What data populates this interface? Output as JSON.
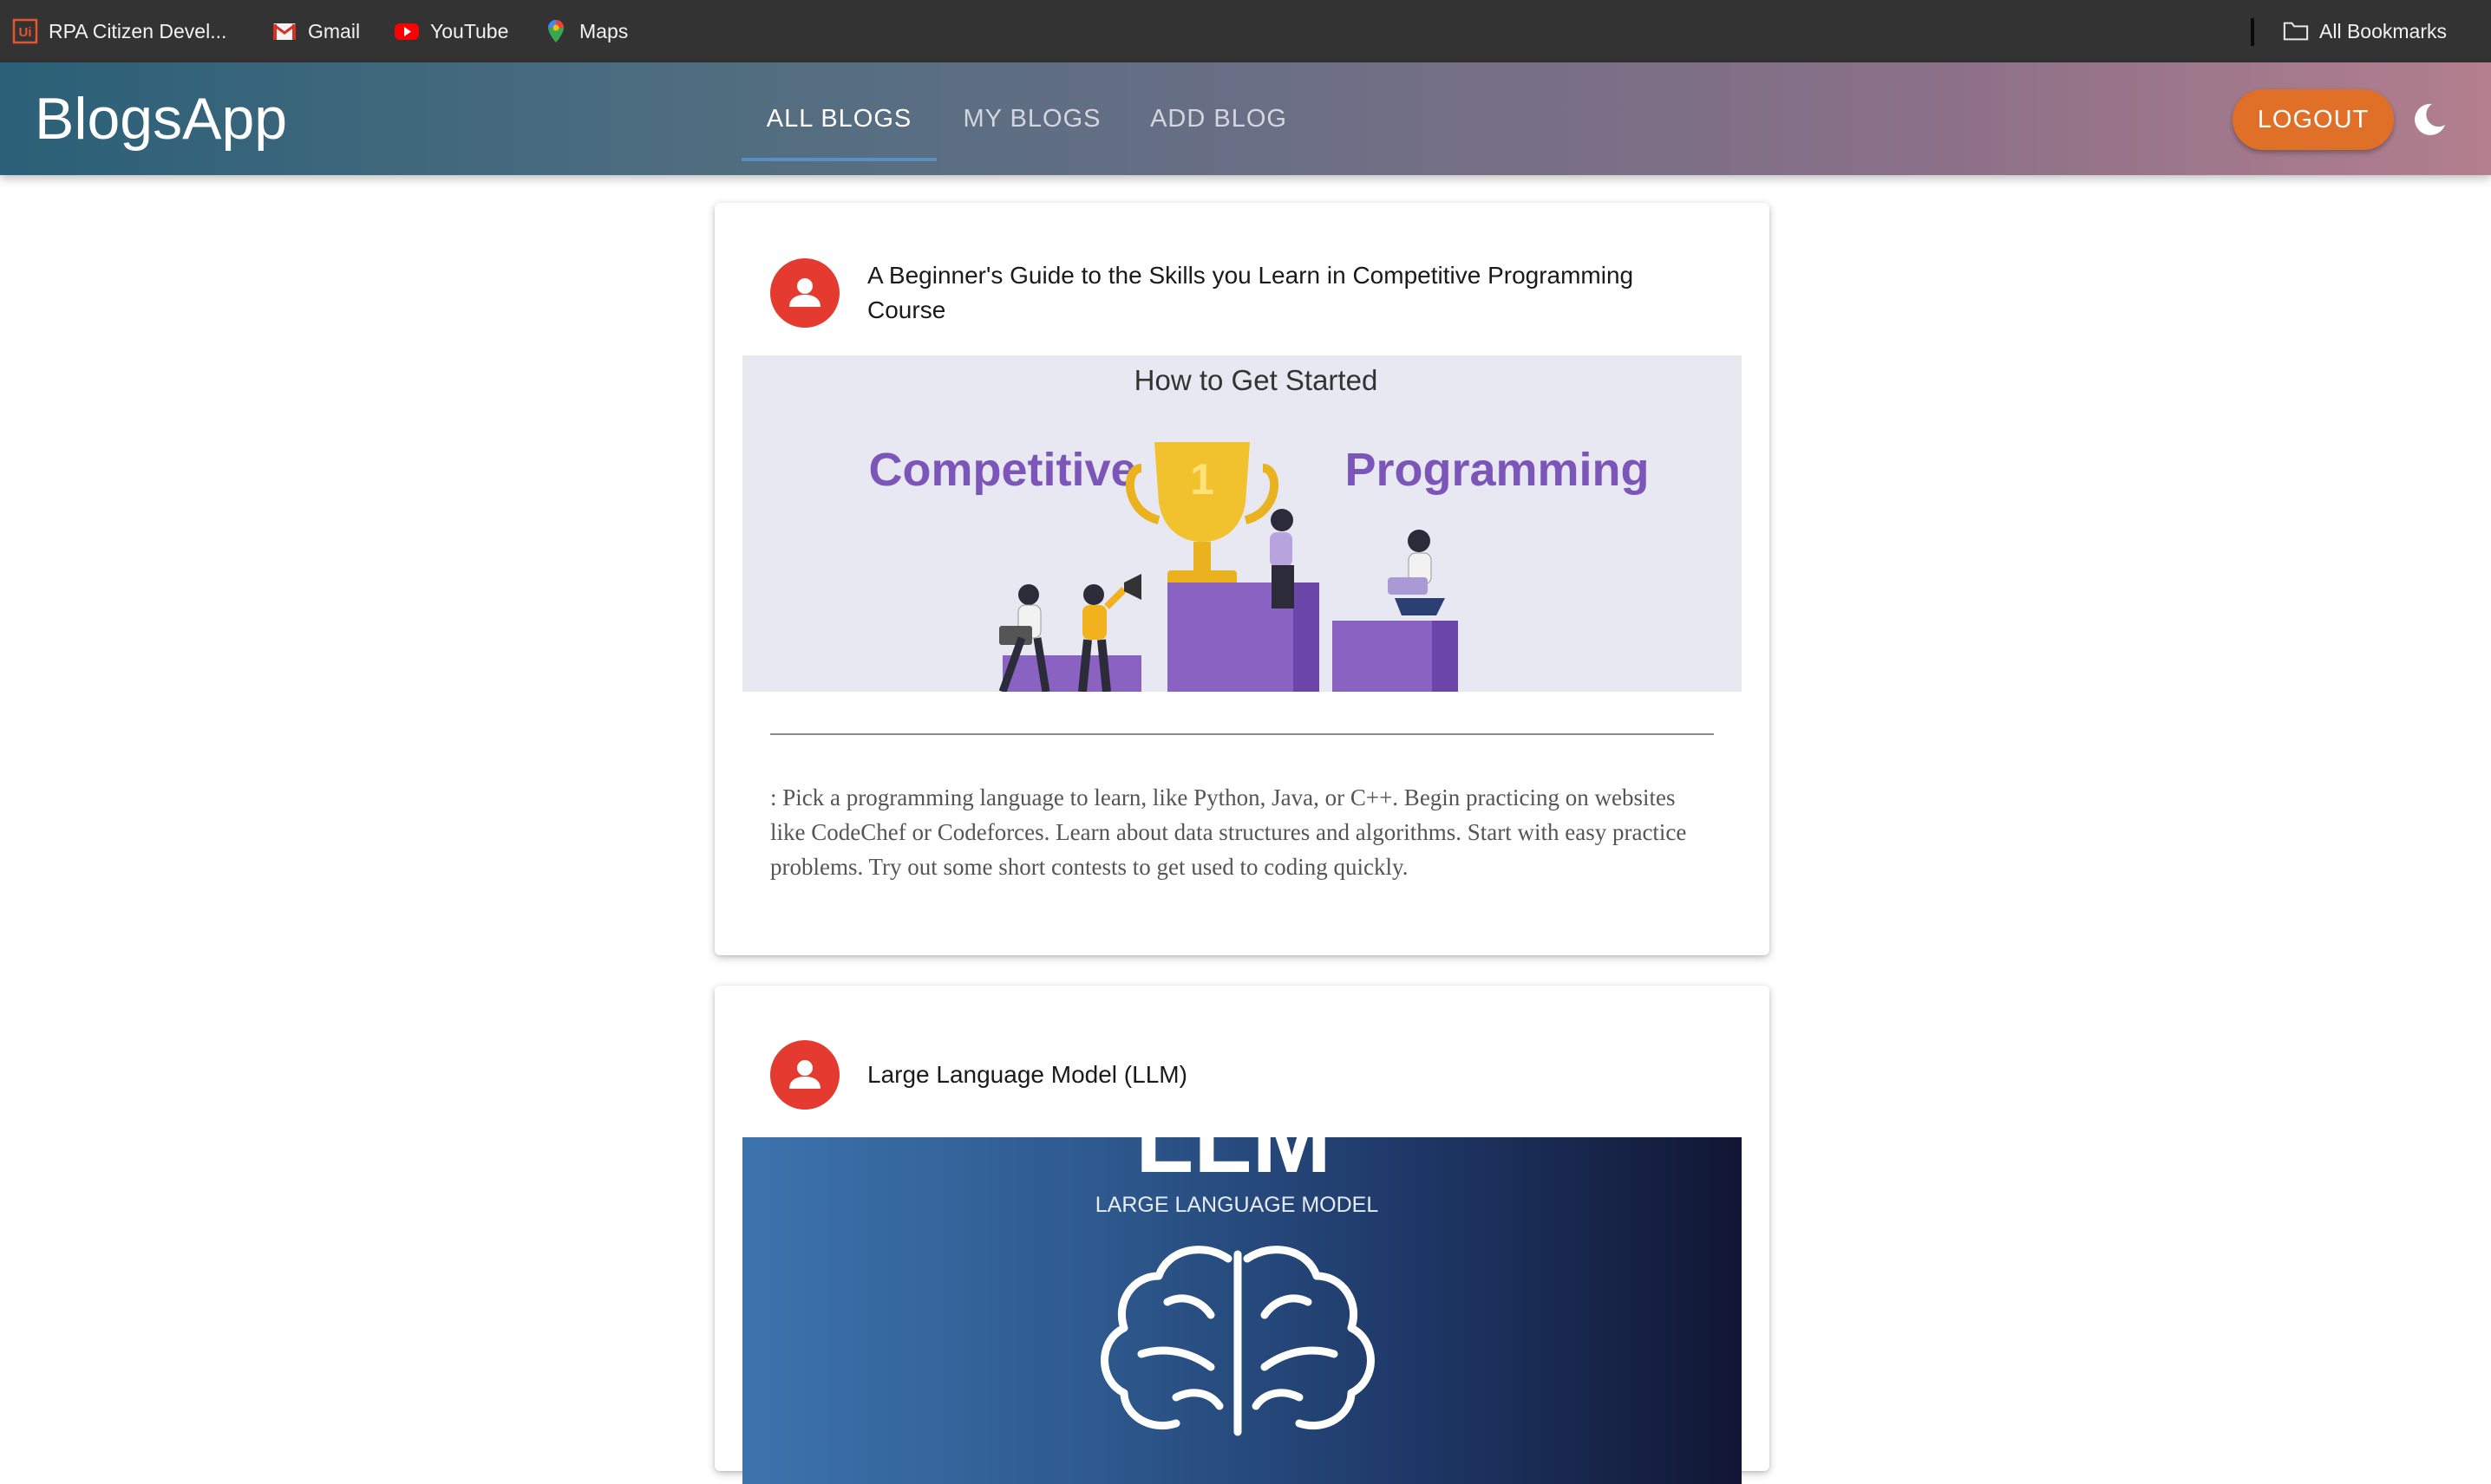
{
  "bookmarks_bar": {
    "items": [
      {
        "label": "RPA Citizen Devel...",
        "icon": "uipath-icon"
      },
      {
        "label": "Gmail",
        "icon": "gmail-icon"
      },
      {
        "label": "YouTube",
        "icon": "youtube-icon"
      },
      {
        "label": "Maps",
        "icon": "maps-icon"
      }
    ],
    "all_bookmarks": "All Bookmarks"
  },
  "appbar": {
    "brand": "BlogsApp",
    "tabs": [
      {
        "label": "ALL BLOGS",
        "active": true
      },
      {
        "label": "MY BLOGS",
        "active": false
      },
      {
        "label": "ADD BLOG",
        "active": false
      }
    ],
    "logout_label": "LOGOUT",
    "theme_icon": "moon-icon"
  },
  "blogs": [
    {
      "title": "A Beginner's Guide to the Skills you Learn in Competitive Programming Course",
      "image": {
        "heading": "How to Get Started",
        "left_word": "Competitive",
        "right_word": "Programming",
        "trophy_number": "1"
      },
      "description": ": Pick a programming language to learn, like Python, Java, or C++. Begin practicing on websites like CodeChef or Codeforces. Learn about data structures and algorithms. Start with easy practice problems. Try out some short contests to get used to coding quickly."
    },
    {
      "title": "Large Language Model (LLM)",
      "image": {
        "big_text": "LLM",
        "subtitle": "LARGE LANGUAGE MODEL"
      }
    }
  ],
  "colors": {
    "bookmarks_bg": "#333333",
    "logout_bg": "#e07028",
    "avatar_bg": "#e53a2f",
    "cp_purple": "#7c55b8"
  }
}
